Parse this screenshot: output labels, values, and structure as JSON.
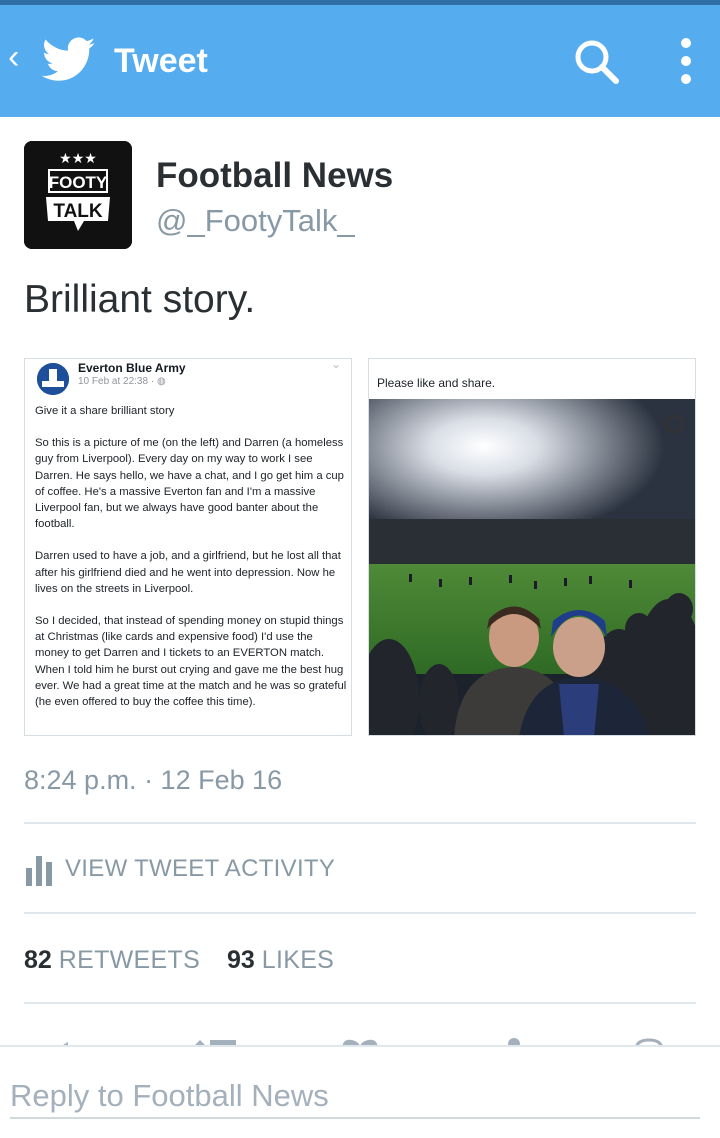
{
  "header": {
    "back_icon": "chevron-left-icon",
    "brand_icon": "twitter-bird-icon",
    "title": "Tweet",
    "search_icon": "search-icon",
    "overflow_icon": "more-vertical-icon",
    "bar_color": "#55acee"
  },
  "author": {
    "avatar_stars": "★★★",
    "avatar_line1": "FOOTY",
    "avatar_line2": "TALK",
    "display_name": "Football News",
    "handle": "@_FootyTalk_"
  },
  "tweet": {
    "text": "Brilliant story.",
    "timestamp": "8:24 p.m. · 12 Feb 16"
  },
  "media_left": {
    "page_name": "Everton Blue Army",
    "date": "10 Feb at 22:38 · ",
    "paragraphs": [
      "Give it a share brilliant story",
      "So this is a picture of me (on the left) and Darren (a homeless guy from Liverpool). Every day on my way to work I see Darren. He says hello, we have a chat, and I go get him a cup of coffee. He's a massive Everton fan and I'm a massive Liverpool fan, but we always have good banter about the football.",
      "Darren used to have a job, and a girlfriend, but he lost all that after his girlfriend died and he went into depression. Now he lives on the streets in Liverpool.",
      "So I decided, that instead of spending money on stupid things at Christmas (like cards and expensive food) I'd use the money to get Darren and I tickets to an EVERTON match. When I told him he burst out crying and gave me the best hug ever. We had a great time at the match and he was so grateful (he even offered to buy the coffee this time)."
    ]
  },
  "media_right": {
    "caption": "Please like and share."
  },
  "activity": {
    "icon": "bar-chart-icon",
    "label": "VIEW TWEET ACTIVITY"
  },
  "stats": {
    "retweets_count": "82",
    "retweets_label": "RETWEETS",
    "likes_count": "93",
    "likes_label": "LIKES"
  },
  "actions": [
    "reply-icon",
    "retweet-icon",
    "like-icon",
    "share-icon",
    "more-icon"
  ],
  "reply": {
    "placeholder": "Reply to Football News"
  }
}
